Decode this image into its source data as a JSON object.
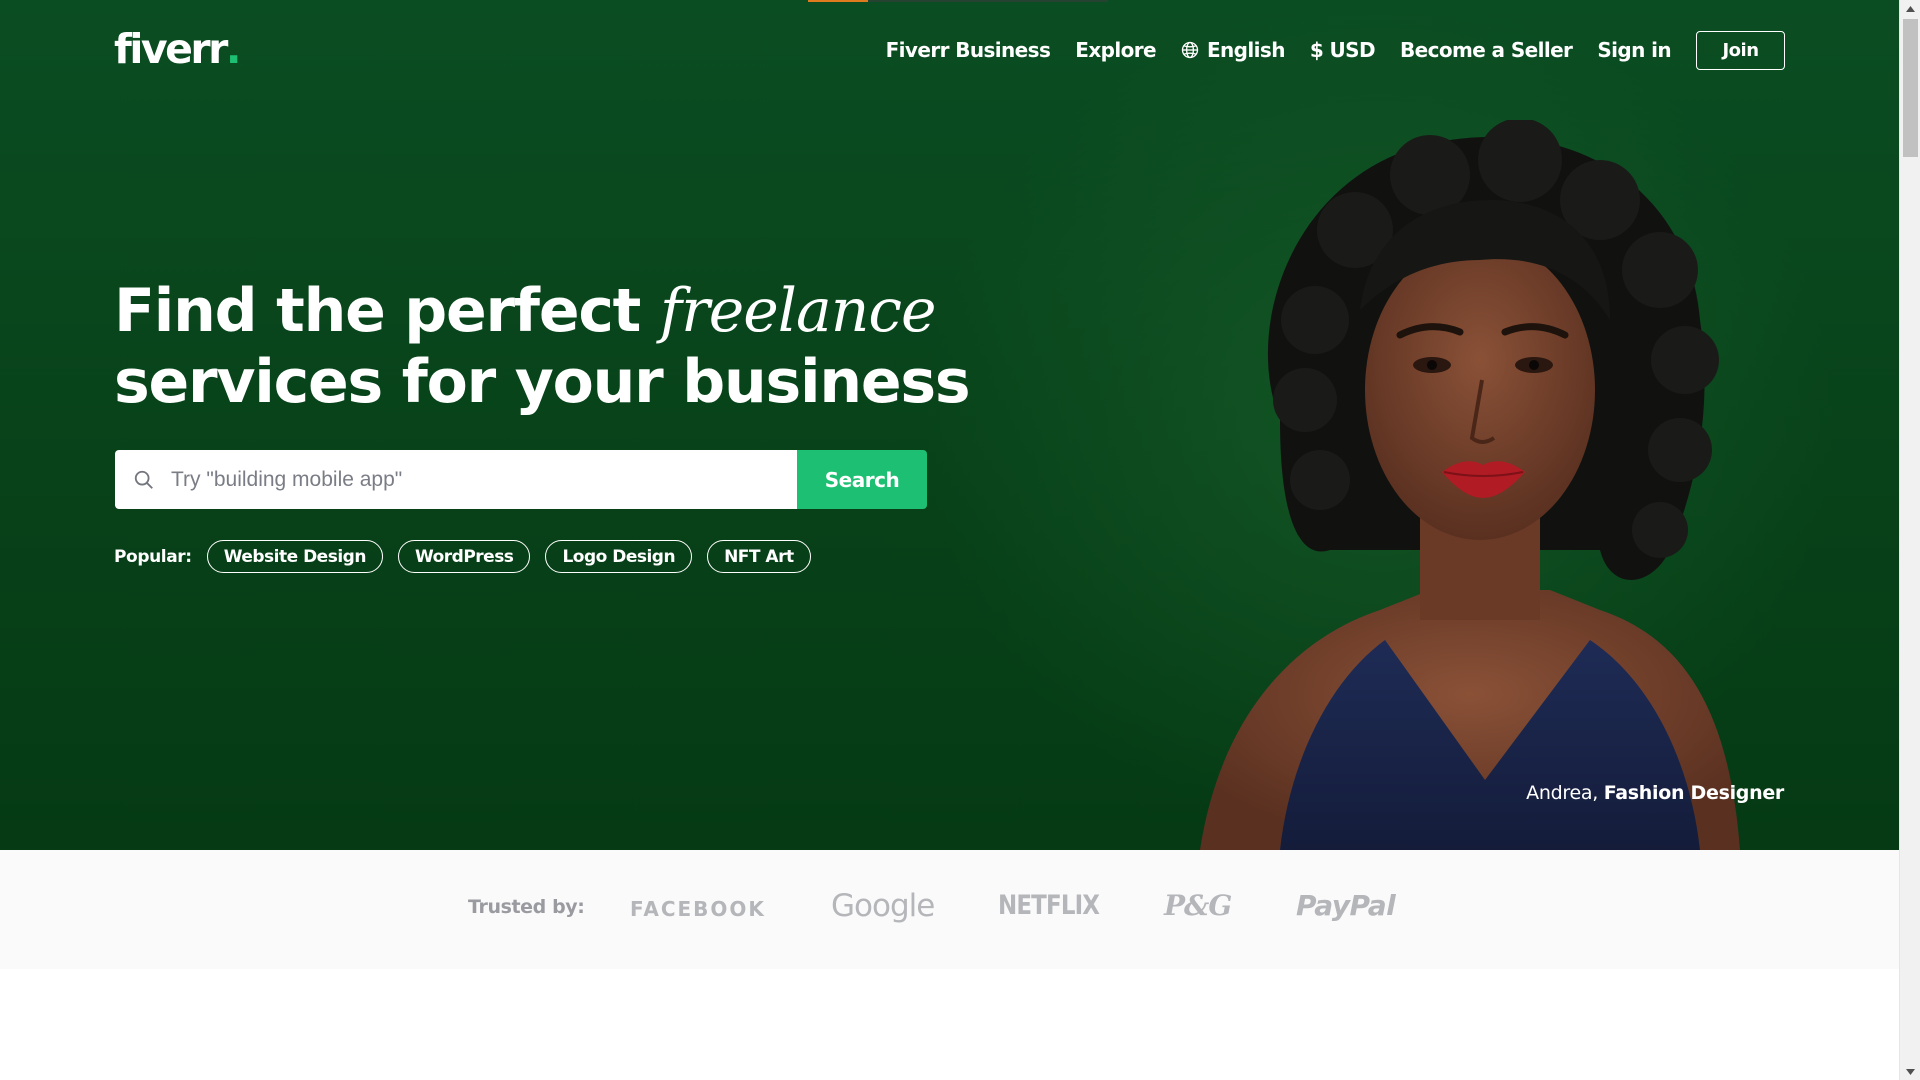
{
  "header": {
    "logo_text": "fiverr",
    "logo_dot": ".",
    "nav": {
      "business": "Fiverr Business",
      "explore": "Explore",
      "language": "English",
      "currency": "$ USD",
      "become_seller": "Become a Seller",
      "sign_in": "Sign in",
      "join": "Join"
    }
  },
  "hero": {
    "headline_part1": "Find the perfect ",
    "headline_italic": "freelance",
    "headline_line2": "services for your business",
    "search": {
      "placeholder": "Try \"building mobile app\"",
      "value": "",
      "button": "Search"
    },
    "popular": {
      "label": "Popular:",
      "tags": [
        "Website Design",
        "WordPress",
        "Logo Design",
        "NFT Art"
      ]
    },
    "caption": {
      "name": "Andrea,",
      "role": "Fashion Designer"
    }
  },
  "trusted": {
    "label": "Trusted by:",
    "brands": {
      "facebook": "FACEBOOK",
      "google": "Google",
      "netflix": "NETFLIX",
      "pg": "P&G",
      "paypal": "PayPal"
    }
  },
  "colors": {
    "hero_bg": "#0a4a20",
    "accent_green": "#1dbf73",
    "brand_gray": "#b5b6ba"
  },
  "icons": {
    "globe": "globe-icon",
    "search": "search-icon"
  },
  "loading_progress": 0.2
}
